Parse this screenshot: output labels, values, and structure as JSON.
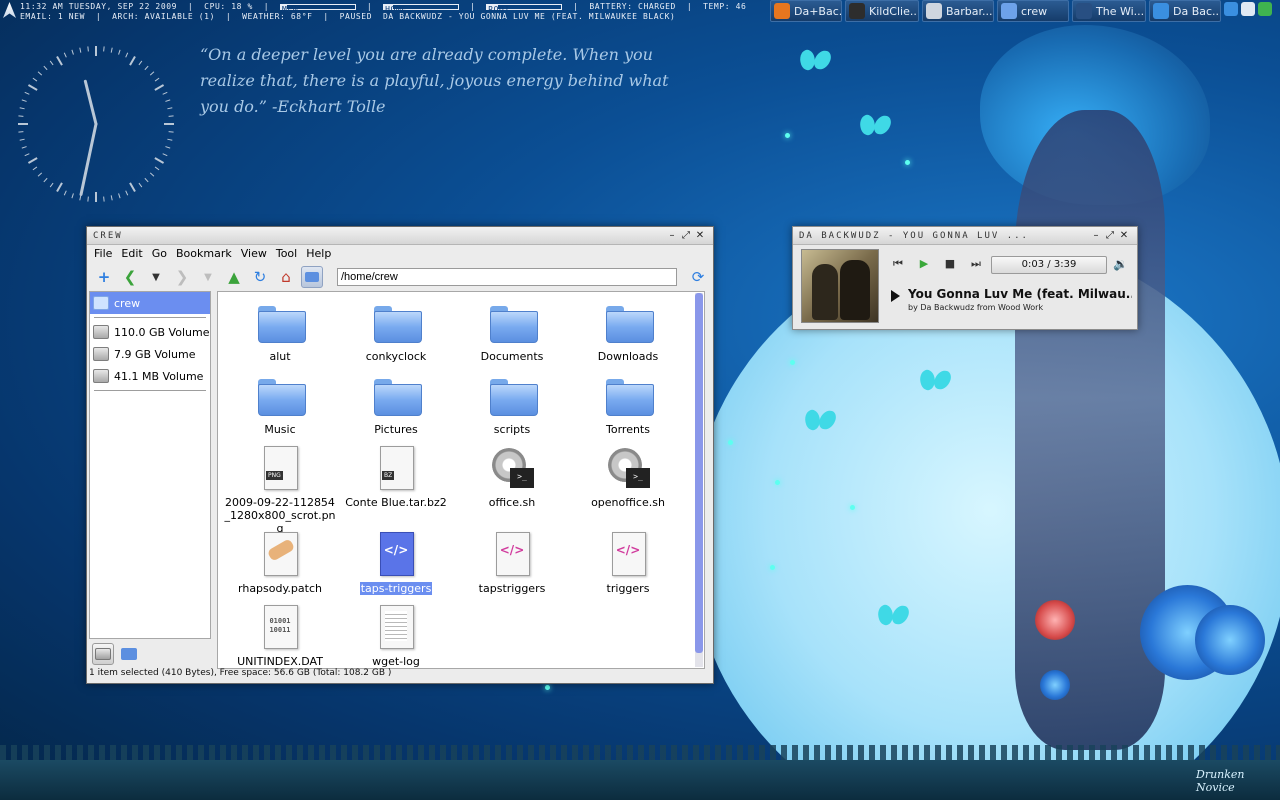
{
  "conky": {
    "line1": {
      "datetime": "11:32 AM TUESDAY, SEP 22 2009",
      "cpu_label": "CPU:",
      "cpu_value": "18 %",
      "mem_label": "MEM",
      "mem_level": 0.08,
      "home_label": "HOME",
      "home_level": 0.12,
      "root_label": "ROOT",
      "root_level": 0.15,
      "battery": "BATTERY: CHARGED",
      "temp": "TEMP: 46"
    },
    "line2": {
      "email": "EMAIL: 1 NEW",
      "arch": "ARCH: AVAILABLE (1)",
      "weather": "WEATHER: 68°F",
      "status": "PAUSED",
      "track": "DA BACKWUDZ - YOU GONNA LUV ME (FEAT. MILWAUKEE BLACK)"
    }
  },
  "taskbar": {
    "tasks": [
      {
        "label": "Da+Bac...",
        "icon": "firefox-icon",
        "color": "#e7761f"
      },
      {
        "label": "KildClie...",
        "icon": "kildclient-icon",
        "color": "#2d2d2d"
      },
      {
        "label": "Barbar...",
        "icon": "clock-app-icon",
        "color": "#cfd6df"
      },
      {
        "label": "crew",
        "icon": "folder-icon",
        "color": "#6da2ea"
      },
      {
        "label": "The Wi...",
        "icon": "window-icon",
        "color": "#284f82"
      },
      {
        "label": "Da Bac...",
        "icon": "music-note-icon",
        "color": "#3a8fe0"
      }
    ],
    "tray": [
      {
        "icon": "music-tray-icon",
        "color": "#3a8fe0"
      },
      {
        "icon": "network-tray-icon",
        "color": "#dfe9f4"
      },
      {
        "icon": "update-tray-icon",
        "color": "#3fb34f"
      }
    ]
  },
  "clock": {
    "hour": 11,
    "minute": 32,
    "color": "#b9c7d6"
  },
  "quote": {
    "text": "“On a deeper level you are already complete. When you realize that, there is a playful, joyous energy behind what you do.” -Eckhart Tolle"
  },
  "file_manager": {
    "title": "CREW",
    "menu": [
      "File",
      "Edit",
      "Go",
      "Bookmark",
      "View",
      "Tool",
      "Help"
    ],
    "path": "/home/crew",
    "side_items": [
      {
        "label": "crew",
        "kind": "home",
        "selected": true
      },
      {
        "label": "110.0 GB Volume",
        "kind": "drive",
        "selected": false
      },
      {
        "label": "7.9 GB Volume",
        "kind": "drive",
        "selected": false
      },
      {
        "label": "41.1 MB Volume",
        "kind": "drive",
        "selected": false
      }
    ],
    "files": [
      {
        "name": "alut",
        "type": "folder",
        "selected": false
      },
      {
        "name": "conkyclock",
        "type": "folder",
        "selected": false
      },
      {
        "name": "Documents",
        "type": "folder",
        "selected": false
      },
      {
        "name": "Downloads",
        "type": "folder",
        "selected": false
      },
      {
        "name": "Music",
        "type": "folder",
        "selected": false
      },
      {
        "name": "Pictures",
        "type": "folder",
        "selected": false
      },
      {
        "name": "scripts",
        "type": "folder",
        "selected": false
      },
      {
        "name": "Torrents",
        "type": "folder",
        "selected": false
      },
      {
        "name": "2009-09-22-112854_1280x800_scrot.png",
        "type": "png",
        "badge": "PNG",
        "selected": false
      },
      {
        "name": "Conte Blue.tar.bz2",
        "type": "archive",
        "badge": "BZ",
        "selected": false
      },
      {
        "name": "office.sh",
        "type": "script",
        "selected": false
      },
      {
        "name": "openoffice.sh",
        "type": "script",
        "selected": false
      },
      {
        "name": "rhapsody.patch",
        "type": "patch",
        "selected": false
      },
      {
        "name": "taps-triggers",
        "type": "code",
        "selected": true
      },
      {
        "name": "tapstriggers",
        "type": "code",
        "selected": false
      },
      {
        "name": "triggers",
        "type": "code",
        "selected": false
      },
      {
        "name": "UNITINDEX.DAT",
        "type": "binary",
        "symbol": "01001 10011",
        "selected": false
      },
      {
        "name": "wget-log",
        "type": "text",
        "selected": false
      }
    ],
    "status": "1 item selected (410 Bytes), Free space: 56.6 GB (Total: 108.2 GB )"
  },
  "player": {
    "title": "DA BACKWUDZ - YOU GONNA LUV ...",
    "time": "0:03 / 3:39",
    "song": "You Gonna Luv Me (feat. Milwau...",
    "byline": "by Da Backwudz from Wood Work"
  },
  "wallpaper": {
    "signature": "Drunken Novice",
    "colors": {
      "sky": "#0b4f95",
      "moon": "#a7e2fa",
      "accent": "#5dfff0"
    }
  }
}
